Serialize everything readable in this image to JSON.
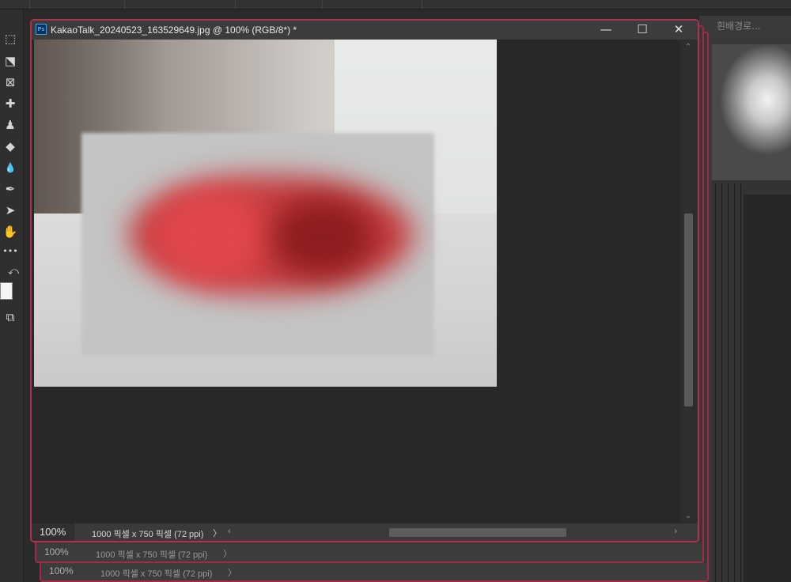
{
  "document": {
    "title": "KakaoTalk_20240523_163529649.jpg @ 100% (RGB/8*) *",
    "app_badge": "Ps",
    "controls": {
      "minimize": "—",
      "maximize": "☐",
      "close": "✕"
    },
    "status": {
      "zoom": "100%",
      "info": "1000 픽셀 x 750 픽셀 (72 ppi)",
      "chevron": "〉",
      "scroll_left": "‹",
      "scroll_right": "›"
    },
    "vscroll": {
      "up": "⌃",
      "down": "⌄"
    }
  },
  "stacked_windows": [
    {
      "zoom": "100%",
      "info": "1000 픽셀 x 750 픽셀 (72 ppi)",
      "chevron": "〉"
    },
    {
      "zoom": "100%",
      "info": "1000 픽셀 x 750 픽셀 (72 ppi)",
      "chevron": "〉"
    }
  ],
  "background_tab": {
    "title": "흰배경로..."
  },
  "tools": [
    {
      "name": "marquee-tool-icon",
      "glyph": "⬚"
    },
    {
      "name": "object-select-tool-icon",
      "glyph": "⬔"
    },
    {
      "name": "frame-tool-icon",
      "glyph": "⊠"
    },
    {
      "name": "healing-brush-tool-icon",
      "glyph": "✚"
    },
    {
      "name": "clone-stamp-tool-icon",
      "glyph": "♟"
    },
    {
      "name": "eraser-tool-icon",
      "glyph": "◆"
    },
    {
      "name": "blur-tool-icon",
      "glyph": "💧"
    },
    {
      "name": "pen-tool-icon",
      "glyph": "✒"
    },
    {
      "name": "path-select-tool-icon",
      "glyph": "➤"
    },
    {
      "name": "hand-tool-icon",
      "glyph": "✋"
    },
    {
      "name": "more-tools-icon",
      "glyph": "•••"
    },
    {
      "name": "swap-colors-icon",
      "glyph": "⤺"
    },
    {
      "name": "screen-mode-icon",
      "glyph": "⧉"
    }
  ],
  "colors": {
    "window_border": "#b2314f",
    "accent_blue": "#31a8ff",
    "foreground_swatch": "#f4f4f4"
  }
}
